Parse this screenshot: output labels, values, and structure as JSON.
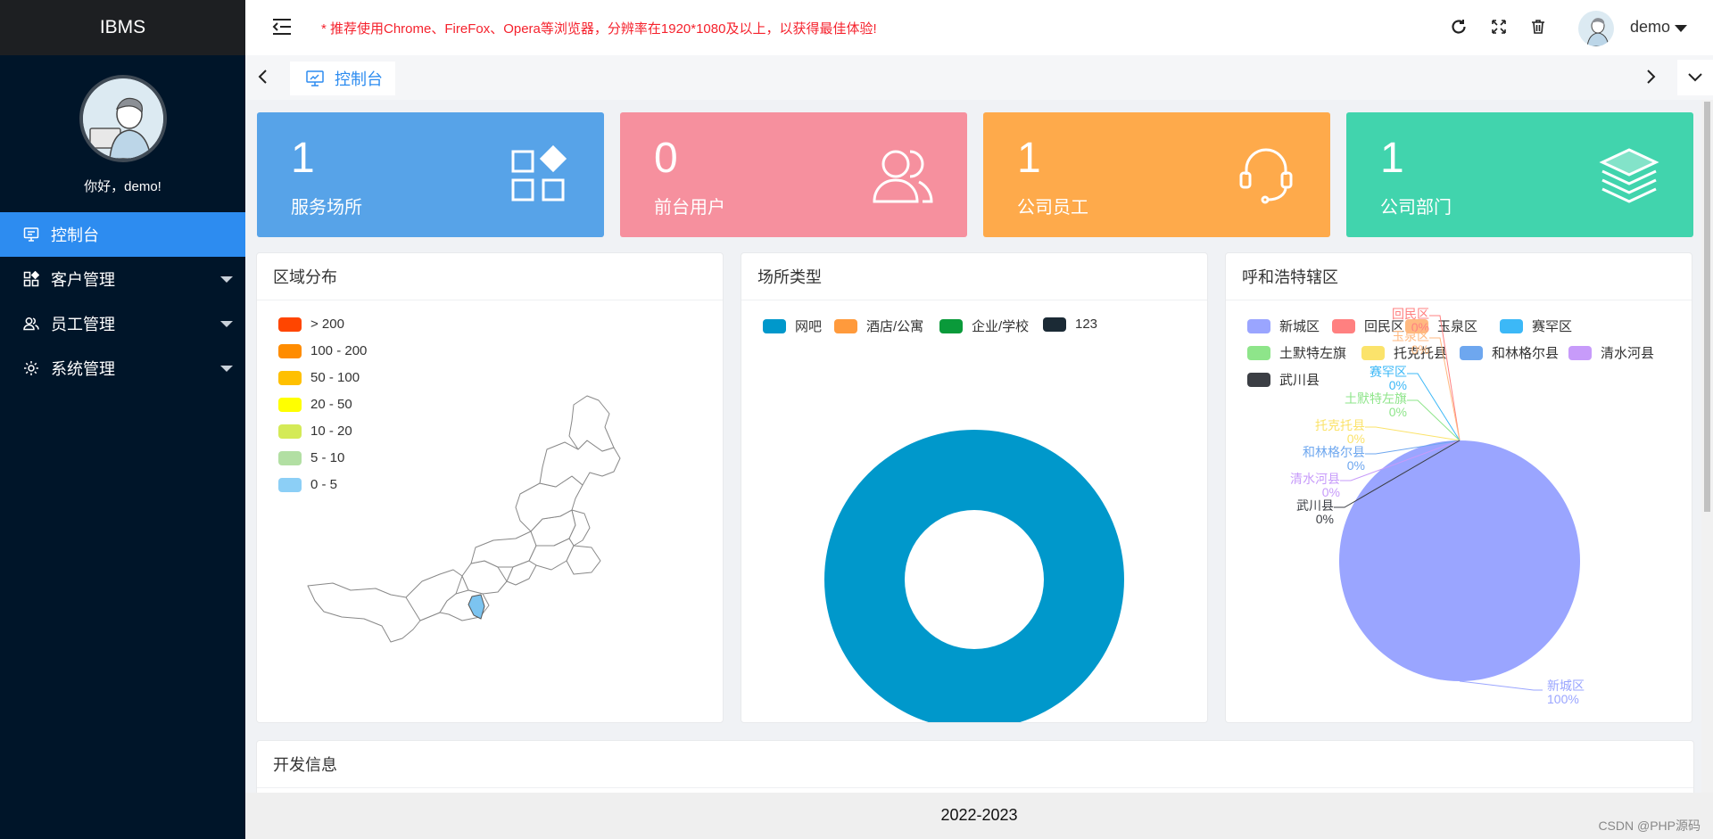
{
  "app": {
    "brand": "IBMS"
  },
  "sidebar": {
    "greeting": "你好，demo!",
    "items": [
      {
        "label": "控制台",
        "icon": "monitor-icon",
        "active": true
      },
      {
        "label": "客户管理",
        "icon": "apps-icon"
      },
      {
        "label": "员工管理",
        "icon": "users-icon"
      },
      {
        "label": "系统管理",
        "icon": "gear-icon"
      }
    ]
  },
  "header": {
    "notice": "* 推荐使用Chrome、FireFox、Opera等浏览器，分辨率在1920*1080及以上，以获得最佳体验!",
    "user": "demo"
  },
  "tabs": [
    {
      "label": "控制台",
      "icon": "dashboard-icon"
    }
  ],
  "stats": [
    {
      "value": "1",
      "label": "服务场所",
      "color": "#57a3e8",
      "icon": "apps-icon"
    },
    {
      "value": "0",
      "label": "前台用户",
      "color": "#f6909e",
      "icon": "users-icon"
    },
    {
      "value": "1",
      "label": "公司员工",
      "color": "#feaa4b",
      "icon": "headset-icon"
    },
    {
      "value": "1",
      "label": "公司部门",
      "color": "#41d4ad",
      "icon": "layers-icon"
    }
  ],
  "panels": {
    "region": {
      "title": "区域分布",
      "legend": [
        {
          "label": "> 200",
          "color": "#ff4500"
        },
        {
          "label": "100 - 200",
          "color": "#ff8c00"
        },
        {
          "label": "50 - 100",
          "color": "#ffc000"
        },
        {
          "label": "20 - 50",
          "color": "#ffff00"
        },
        {
          "label": "10 - 20",
          "color": "#d4ea57"
        },
        {
          "label": "5 - 10",
          "color": "#b2dfa3"
        },
        {
          "label": "0 - 5",
          "color": "#8ccff6"
        }
      ]
    },
    "venue": {
      "title": "场所类型",
      "legend": [
        {
          "label": "网吧",
          "color": "#0098cb"
        },
        {
          "label": "酒店/公寓",
          "color": "#ff9a3c"
        },
        {
          "label": "企业/学校",
          "color": "#0a9a3a"
        },
        {
          "label": "123",
          "color": "#1b2a35"
        }
      ]
    },
    "district": {
      "title": "呼和浩特辖区",
      "legend": [
        {
          "label": "新城区",
          "color": "#9aa5ff"
        },
        {
          "label": "回民区",
          "color": "#ff8080"
        },
        {
          "label": "玉泉区",
          "color": "#ffb980"
        },
        {
          "label": "赛罕区",
          "color": "#3cb8f7"
        },
        {
          "label": "土默特左旗",
          "color": "#8ee58a"
        },
        {
          "label": "托克托县",
          "color": "#fbe36b"
        },
        {
          "label": "和林格尔县",
          "color": "#6ea7ef"
        },
        {
          "label": "清水河县",
          "color": "#c79bfa"
        },
        {
          "label": "武川县",
          "color": "#3b3e44"
        }
      ],
      "pct_zero": "0%",
      "main_label": "新城区",
      "main_pct": "100%"
    },
    "dev": {
      "title": "开发信息"
    }
  },
  "chart_data": [
    {
      "type": "pie",
      "title": "场所类型",
      "labels": [
        "网吧",
        "酒店/公寓",
        "企业/学校",
        "123"
      ],
      "values": [
        1,
        0,
        0,
        0
      ]
    },
    {
      "type": "pie",
      "title": "呼和浩特辖区",
      "labels": [
        "新城区",
        "回民区",
        "玉泉区",
        "赛罕区",
        "土默特左旗",
        "托克托县",
        "和林格尔县",
        "清水河县",
        "武川县"
      ],
      "values": [
        1,
        0,
        0,
        0,
        0,
        0,
        0,
        0,
        0
      ]
    }
  ],
  "footer": {
    "copyright": "2022-2023",
    "watermark": "CSDN @PHP源码"
  }
}
